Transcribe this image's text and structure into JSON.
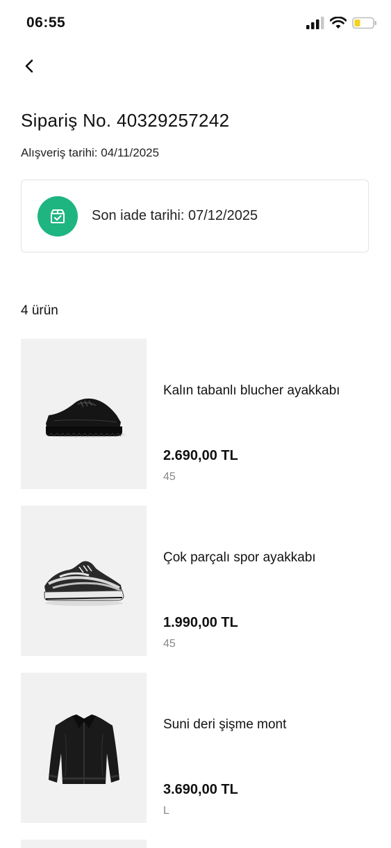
{
  "status_bar": {
    "time": "06:55"
  },
  "order": {
    "title": "Sipariş No. 40329257242",
    "purchase_date": "Alışveriş tarihi: 04/11/2025",
    "return_deadline": "Son iade tarihi: 07/12/2025",
    "items_count": "4 ürün"
  },
  "products": [
    {
      "name": "Kalın tabanlı blucher ayakkabı",
      "price": "2.690,00 TL",
      "size": "45",
      "icon": "shoe-image"
    },
    {
      "name": "Çok parçalı spor ayakkabı",
      "price": "1.990,00 TL",
      "size": "45",
      "icon": "sneaker-image"
    },
    {
      "name": "Suni deri şişme mont",
      "price": "3.690,00 TL",
      "size": "L",
      "icon": "jacket-image"
    }
  ],
  "colors": {
    "accent_green": "#1fb581",
    "image_background": "#f1f1f1",
    "muted_text": "#888888"
  }
}
